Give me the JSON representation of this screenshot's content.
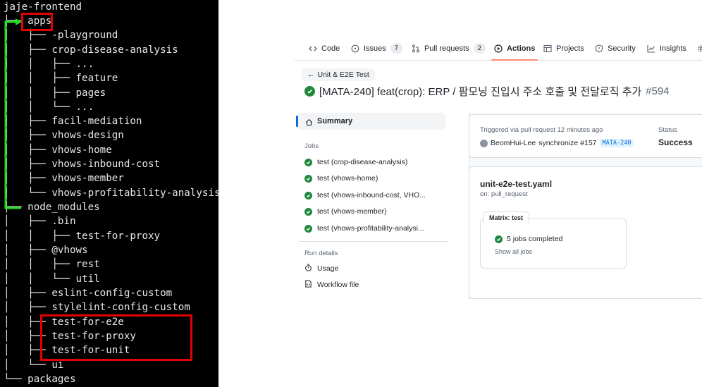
{
  "terminal": {
    "lines": [
      "jaje-frontend",
      "├── apps",
      "│   ├── -playground",
      "│   ├── crop-disease-analysis",
      "│   │   ├── ...",
      "│   │   ├── feature",
      "│   │   ├── pages",
      "│   │   └── ...",
      "│   ├── facil-mediation",
      "│   ├── vhows-design",
      "│   ├── vhows-home",
      "│   ├── vhows-inbound-cost",
      "│   ├── vhows-member",
      "│   └── vhows-profitability-analysis",
      "├── node_modules",
      "│   ├── .bin",
      "│   │   ├── test-for-proxy",
      "│   ├── @vhows",
      "│   │   ├── rest",
      "│   │   └── util",
      "│   ├── eslint-config-custom",
      "│   ├── stylelint-config-custom",
      "│   ├── test-for-e2e",
      "│   ├── test-for-proxy",
      "│   ├── test-for-unit",
      "│   └── ui",
      "└── packages"
    ],
    "highlight_color": "#e50000",
    "arrow_color": "#22dd22"
  },
  "github": {
    "tabs": [
      {
        "label": "Code",
        "icon": "code-icon"
      },
      {
        "label": "Issues",
        "icon": "issue-icon",
        "count": "7"
      },
      {
        "label": "Pull requests",
        "icon": "pull-request-icon",
        "count": "2"
      },
      {
        "label": "Actions",
        "icon": "play-icon",
        "active": true
      },
      {
        "label": "Projects",
        "icon": "table-icon"
      },
      {
        "label": "Security",
        "icon": "shield-icon"
      },
      {
        "label": "Insights",
        "icon": "graph-icon"
      }
    ],
    "back_link": "Unit & E2E Test",
    "run_title": "[MATA-240] feat(crop): ERP / 팜모닝 진입시 주소 호출 및 전달로직 추가",
    "run_number": "#594",
    "sidebar": {
      "summary": "Summary",
      "jobs_heading": "Jobs",
      "jobs": [
        "test (crop-disease-analysis)",
        "test (vhows-home)",
        "test (vhows-inbound-cost, VHO...",
        "test (vhows-member)",
        "test (vhows-profitability-analysi..."
      ],
      "run_details_heading": "Run details",
      "usage": "Usage",
      "workflow_file": "Workflow file"
    },
    "trigger": {
      "text": "Triggered via pull request 12 minutes ago",
      "user": "BeomHui-Lee",
      "action": "synchronize #157",
      "branch": "MATA-240",
      "status_label": "Status",
      "status_value": "Success"
    },
    "workflow": {
      "filename": "unit-e2e-test.yaml",
      "on": "on: pull_request",
      "matrix_label": "Matrix: test",
      "jobs_completed": "5 jobs completed",
      "show_all": "Show all jobs"
    },
    "colors": {
      "success": "#1f883d",
      "accent": "#0969da",
      "tab_underline": "#fd8c73"
    }
  }
}
